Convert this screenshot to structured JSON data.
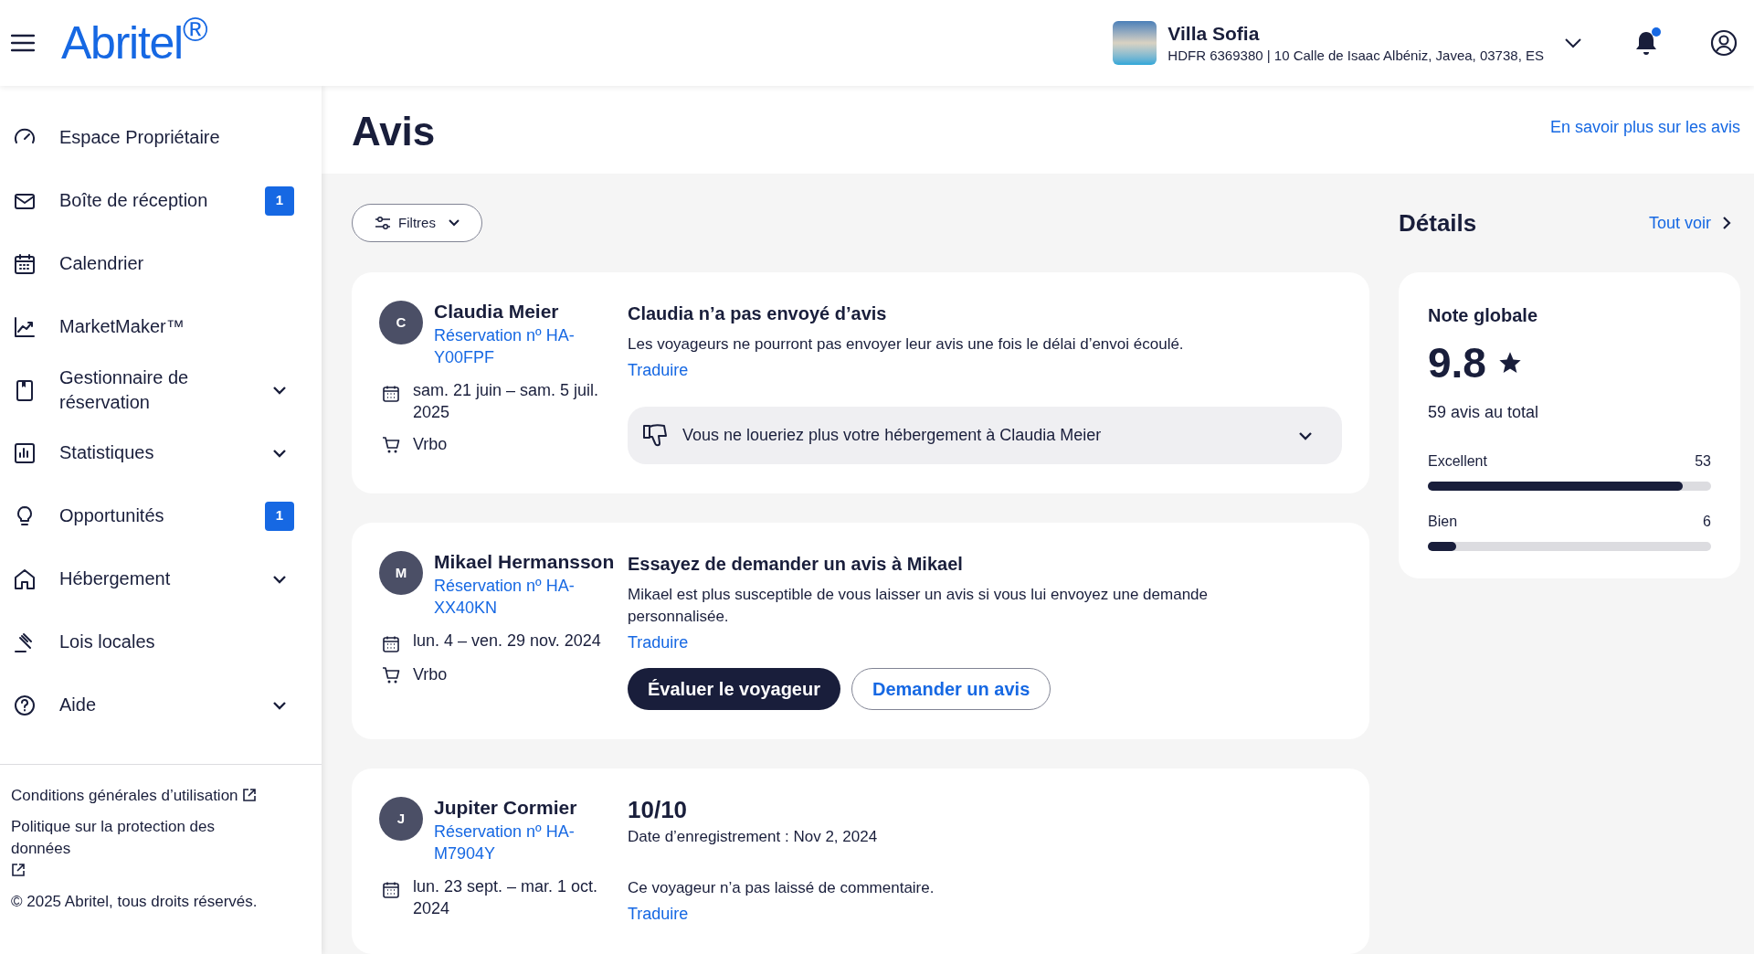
{
  "header": {
    "logo": "Abritel$^{®}$",
    "property": {
      "name": "Villa Sofia",
      "address": "HDFR 6369380 | 10 Calle de Isaac Albéniz, Javea, 03738, ES"
    },
    "notifications": {
      "unread": true
    }
  },
  "sidebar": {
    "items": [
      {
        "label": "Espace Propriétaire",
        "expandable": false
      },
      {
        "label": "Boîte de réception",
        "badge": "1",
        "expandable": false
      },
      {
        "label": "Calendrier",
        "expandable": false
      },
      {
        "label": "MarketMaker™",
        "expandable": false
      },
      {
        "label": "Gestionnaire de réservation",
        "expandable": true
      },
      {
        "label": "Statistiques",
        "expandable": true
      },
      {
        "label": "Opportunités",
        "badge": "1",
        "expandable": false
      },
      {
        "label": "Hébergement",
        "expandable": true
      },
      {
        "label": "Lois locales",
        "expandable": false
      },
      {
        "label": "Aide",
        "expandable": true
      }
    ],
    "footer_links": [
      "Conditions générales d’utilisation",
      "Politique sur la protection des données"
    ],
    "copyright": "© 2025 Abritel, tous droits réservés."
  },
  "page": {
    "title": "Avis",
    "learn_more_link": "En savoir plus sur les avis",
    "filter_button": "Filtres"
  },
  "reviews": [
    {
      "kind": "no_review",
      "initial": "C",
      "guest": "Claudia Meier",
      "reservation": "Réservation nº HA-Y00FPF",
      "dates": "sam. 21 juin – sam. 5 juil. 2025",
      "source": "Vrbo",
      "title": "Claudia n’a pas envoyé d’avis",
      "text": "Les voyageurs ne pourront pas envoyer leur avis une fois le délai d’envoi écoulé.",
      "translate": "Traduire",
      "feedback": "Vous ne loueriez plus votre hébergement à Claudia Meier"
    },
    {
      "kind": "request",
      "initial": "M",
      "guest": "Mikael Hermansson",
      "reservation": "Réservation nº HA-XX40KN",
      "dates": "lun. 4 – ven. 29 nov. 2024",
      "source": "Vrbo",
      "title": "Essayez de demander un avis à Mikael",
      "text": "Mikael est plus susceptible de vous laisser un avis si vous lui envoyez une demande personnalisée.",
      "translate": "Traduire",
      "buttons": [
        "Évaluer le voyageur",
        "Demander un avis"
      ]
    },
    {
      "kind": "rated",
      "initial": "J",
      "guest": "Jupiter Cormier",
      "reservation": "Réservation nº HA-M7904Y",
      "dates": "lun. 23 sept. – mar. 1 oct. 2024",
      "score": "10/10",
      "date_recorded": "Date d’enregistrement : Nov 2, 2024",
      "text": "Ce voyageur n’a pas laissé de commentaire.",
      "translate": "Traduire"
    }
  ],
  "details": {
    "title": "Détails",
    "see_all": "Tout voir",
    "overall_label": "Note globale",
    "score": "9.8",
    "total": "59 avis au total",
    "breakdown": [
      {
        "label": "Excellent",
        "count": "53",
        "level": 0.9
      },
      {
        "label": "Bien",
        "count": "6",
        "level": 0.1
      }
    ]
  }
}
